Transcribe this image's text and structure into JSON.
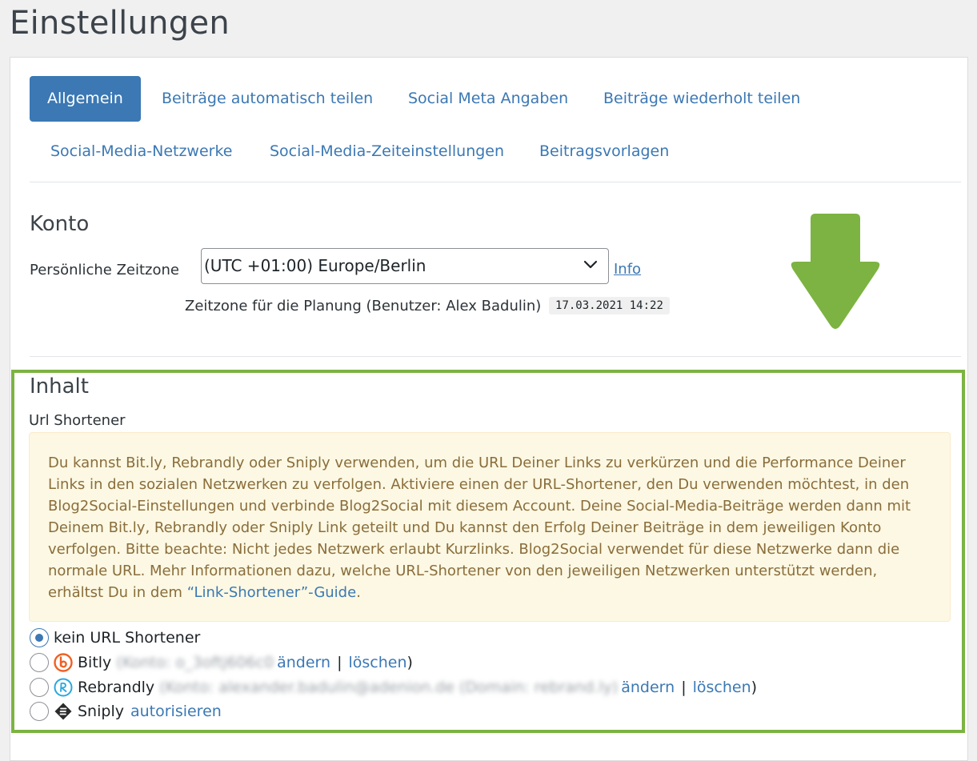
{
  "page": {
    "title": "Einstellungen"
  },
  "tabs": [
    {
      "label": "Allgemein",
      "active": true
    },
    {
      "label": "Beiträge automatisch teilen"
    },
    {
      "label": "Social Meta Angaben"
    },
    {
      "label": "Beiträge wiederholt teilen"
    },
    {
      "label": "Social-Media-Netzwerke"
    },
    {
      "label": "Social-Media-Zeiteinstellungen"
    },
    {
      "label": "Beitragsvorlagen"
    }
  ],
  "konto": {
    "title": "Konto",
    "timezone_label": "Persönliche Zeitzone",
    "timezone_value": "(UTC +01:00) Europe/Berlin",
    "info_link": "Info",
    "planning_text": "Zeitzone für die Planung (Benutzer: Alex Badulin)",
    "planning_time": "17.03.2021 14:22"
  },
  "inhalt": {
    "title": "Inhalt",
    "subtitle": "Url Shortener",
    "notice_text": "Du kannst Bit.ly, Rebrandly oder Sniply verwenden, um die URL Deiner Links zu verkürzen und die Performance Deiner Links in den sozialen Netzwerken zu verfolgen. Aktiviere einen der URL-Shortener, den Du verwenden möchtest, in den Blog2Social-Einstellungen und verbinde Blog2Social mit diesem Account. Deine Social-Media-Beiträge werden dann mit Deinem Bit.ly, Rebrandly oder Sniply Link geteilt und Du kannst den Erfolg Deiner Beiträge in dem jeweiligen Konto verfolgen. Bitte beachte: Nicht jedes Netzwerk erlaubt Kurzlinks. Blog2Social verwendet für diese Netzwerke dann die normale URL. Mehr Informationen dazu, welche URL-Shortener von den jeweiligen Netzwerken unterstützt werden, erhältst Du in dem ",
    "notice_link": "“Link-Shortener”-Guide",
    "notice_end": ".",
    "options": {
      "none": {
        "label": "kein URL Shortener",
        "checked": true
      },
      "bitly": {
        "label": "Bitly",
        "account_blurred": "(Konto: o_3oftj606c0",
        "edit": "ändern",
        "separator": "|",
        "delete": "löschen",
        "close": ")"
      },
      "rebrandly": {
        "label": "Rebrandly",
        "account_blurred": "(Konto: alexander.badulin@adenion.de (Domain: rebrand.ly)",
        "edit": "ändern",
        "separator": "|",
        "delete": "löschen",
        "close": ")"
      },
      "sniply": {
        "label": "Sniply",
        "authorize": "autorisieren"
      }
    }
  },
  "colors": {
    "accent": "#3b78b4",
    "highlight_border": "#7cb342",
    "arrow": "#7cb342",
    "notice_bg": "#fcf8e3",
    "notice_text": "#8a6d3b"
  }
}
